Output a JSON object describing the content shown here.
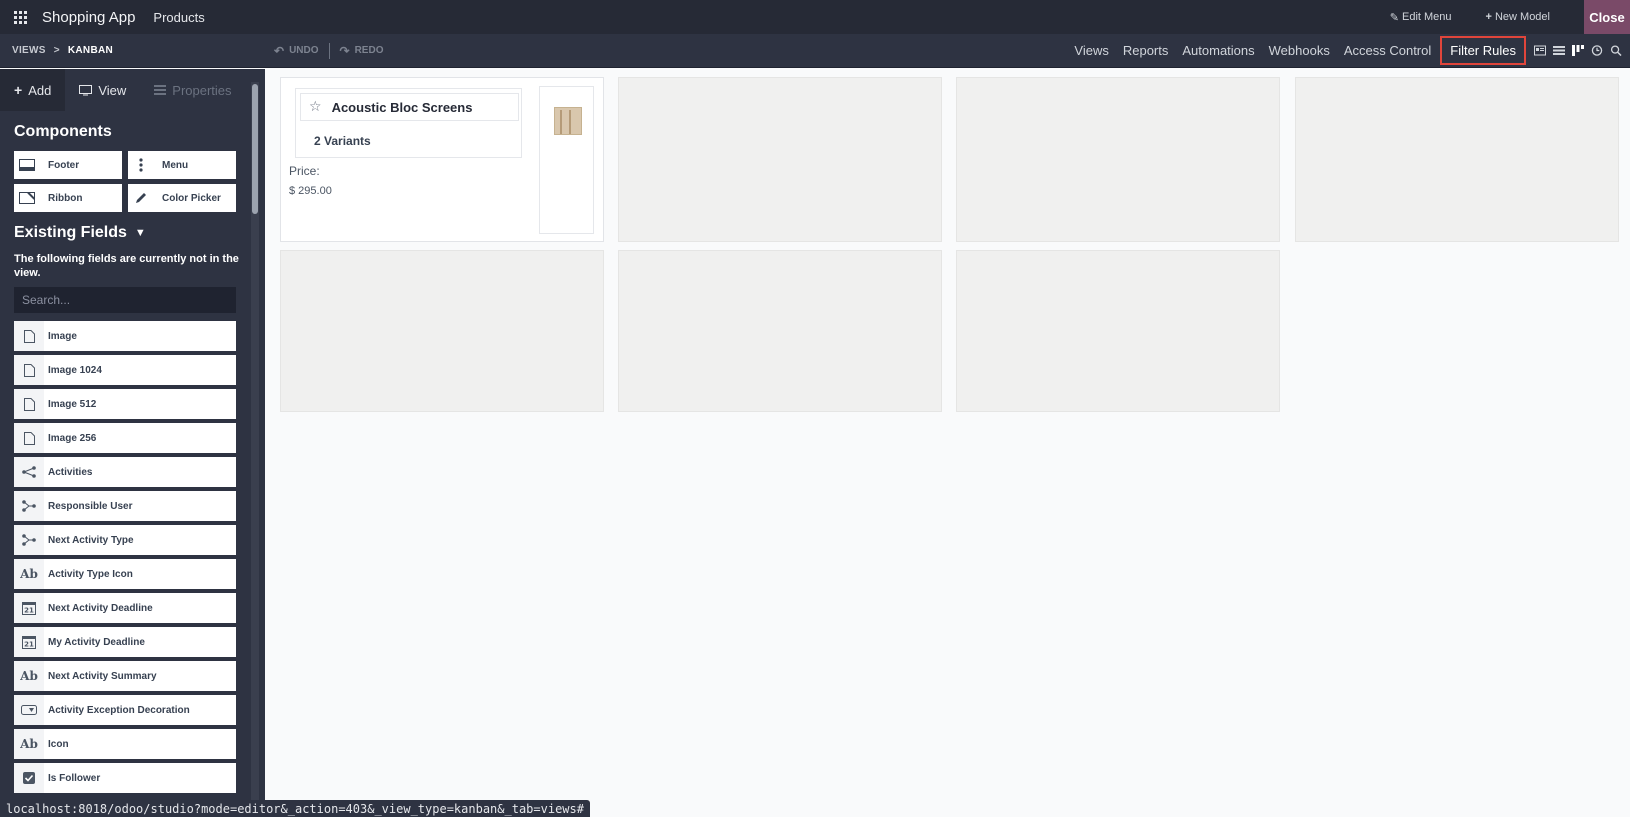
{
  "topbar": {
    "app_title": "Shopping App",
    "menu_item": "Products",
    "edit_menu": "Edit Menu",
    "new_model": "New Model",
    "close": "Close"
  },
  "subbar": {
    "breadcrumb": [
      "VIEWS",
      ">",
      "KANBAN"
    ],
    "undo": "UNDO",
    "redo": "REDO",
    "menu": [
      "Views",
      "Reports",
      "Automations",
      "Webhooks",
      "Access Control",
      "Filter Rules"
    ],
    "highlighted": "Filter Rules",
    "view_icons": [
      "form-view-icon",
      "list-view-icon",
      "kanban-view-icon",
      "activity-view-icon",
      "search-view-icon"
    ]
  },
  "sidebar": {
    "tabs": [
      "Add",
      "View",
      "Properties"
    ],
    "components_title": "Components",
    "components": [
      {
        "label": "Footer",
        "icon": "footer-icon"
      },
      {
        "label": "Menu",
        "icon": "kebab-menu-icon"
      },
      {
        "label": "Ribbon",
        "icon": "ribbon-icon"
      },
      {
        "label": "Color Picker",
        "icon": "pencil-icon"
      }
    ],
    "existing_title": "Existing Fields",
    "description": "The following fields are currently not in the view.",
    "search_placeholder": "Search...",
    "fields": [
      {
        "label": "Image",
        "icon": "file-icon"
      },
      {
        "label": "Image 1024",
        "icon": "file-icon"
      },
      {
        "label": "Image 512",
        "icon": "file-icon"
      },
      {
        "label": "Image 256",
        "icon": "file-icon"
      },
      {
        "label": "Activities",
        "icon": "share-icon"
      },
      {
        "label": "Responsible User",
        "icon": "relation-icon"
      },
      {
        "label": "Next Activity Type",
        "icon": "relation-icon"
      },
      {
        "label": "Activity Type Icon",
        "icon": "text-icon"
      },
      {
        "label": "Next Activity Deadline",
        "icon": "calendar-icon"
      },
      {
        "label": "My Activity Deadline",
        "icon": "calendar-icon"
      },
      {
        "label": "Next Activity Summary",
        "icon": "text-icon"
      },
      {
        "label": "Activity Exception Decoration",
        "icon": "selection-icon"
      },
      {
        "label": "Icon",
        "icon": "text-icon"
      },
      {
        "label": "Is Follower",
        "icon": "checkbox-icon"
      }
    ]
  },
  "kanban": {
    "card": {
      "title": "Acoustic Bloc Screens",
      "variants": "2  Variants",
      "price_label": "Price:",
      "price_value": "$ 295.00"
    }
  },
  "status_url": "localhost:8018/odoo/studio?mode=editor&_action=403&_view_type=kanban&_tab=views#"
}
